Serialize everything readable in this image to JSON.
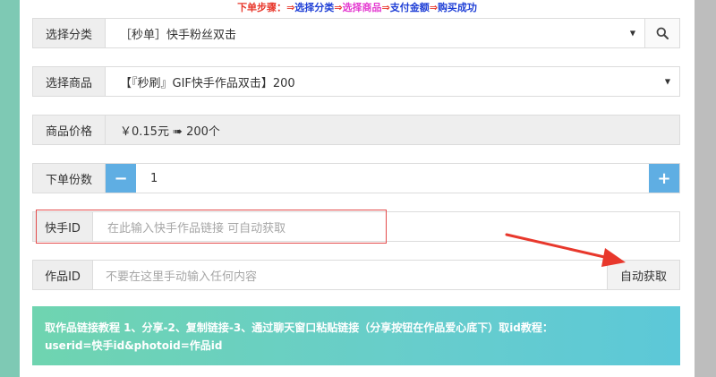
{
  "steps": {
    "prefix": "下单步骤：",
    "arrow": "⇒",
    "s1": "选择分类",
    "s2": "选择商品",
    "s3": "支付金额",
    "s4": "购买成功"
  },
  "category": {
    "label": "选择分类",
    "value": "［秒单］快手粉丝双击"
  },
  "product": {
    "label": "选择商品",
    "value": "【『秒刷』GIF快手作品双击】200"
  },
  "price": {
    "label": "商品价格",
    "value": "￥0.15元 ➠ 200个"
  },
  "quantity": {
    "label": "下单份数",
    "value": "1",
    "minus": "−",
    "plus": "+"
  },
  "kuaishou_id": {
    "label": "快手ID",
    "placeholder": "在此输入快手作品链接 可自动获取"
  },
  "work_id": {
    "label": "作品ID",
    "placeholder": "不要在这里手动输入任何内容",
    "auto_button": "自动获取"
  },
  "banner": {
    "line1": "取作品链接教程 1、分享-2、复制链接-3、通过聊天窗口粘贴链接（分享按钮在作品爱心底下）取id教程：",
    "line2": "userid=快手id&photoid=作品id"
  },
  "colors": {
    "accent": "#5faee3",
    "highlight": "#e34b4b",
    "banner": "#67cdcc"
  }
}
